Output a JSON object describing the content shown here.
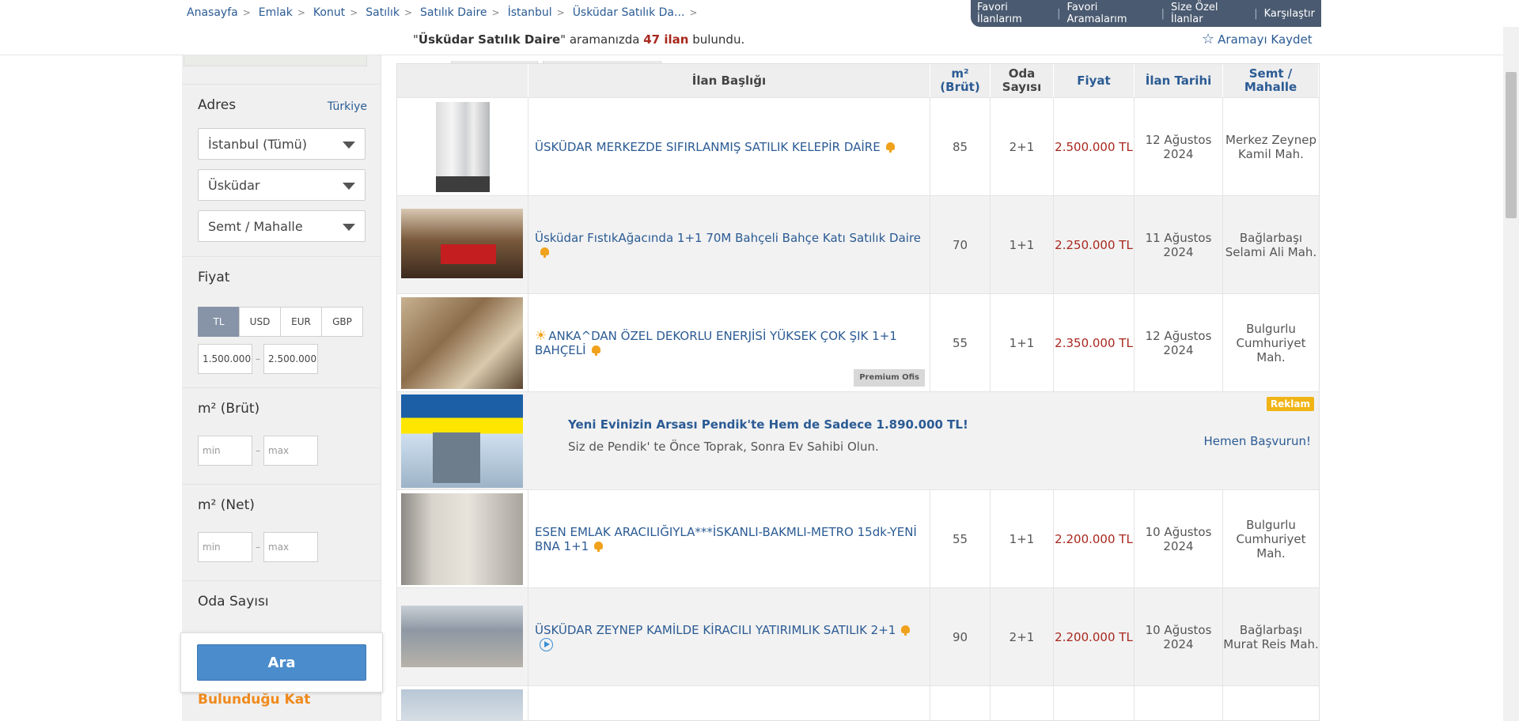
{
  "breadcrumb": [
    "Anasayfa",
    "Emlak",
    "Konut",
    "Satılık",
    "Satılık Daire",
    "İstanbul",
    "Üsküdar Satılık Da..."
  ],
  "topnav": [
    "Favori İlanlarım",
    "Favori Aramalarım",
    "Size Özel İlanlar",
    "Karşılaştır"
  ],
  "results": {
    "query": "Üsküdar Satılık Daire",
    "quote_open": "\"",
    "quote_close": "\"",
    "mid_text": "aramanızda",
    "count": "47 ilan",
    "suffix": "bulundu.",
    "save_label": "Aramayı Kaydet"
  },
  "sidebar": {
    "address": {
      "title": "Adres",
      "country_link": "Türkiye",
      "city": "İstanbul (Tümü)",
      "district": "Üsküdar",
      "neighborhood": "Semt / Mahalle"
    },
    "price": {
      "title": "Fiyat",
      "currencies": [
        "TL",
        "USD",
        "EUR",
        "GBP"
      ],
      "active_currency": "TL",
      "min": "1.500.000",
      "max": "2.500.000",
      "separator": "–"
    },
    "gross_area": {
      "title": "m² (Brüt)",
      "min_placeholder": "min",
      "max_placeholder": "max"
    },
    "net_area": {
      "title": "m² (Net)",
      "min_placeholder": "min",
      "max_placeholder": "max"
    },
    "rooms": {
      "title": "Oda Sayısı"
    },
    "floor": {
      "title": "Bulunduğu Kat"
    },
    "search_button": "Ara"
  },
  "table": {
    "headers": [
      "İlan Başlığı",
      "m² (Brüt)",
      "Oda Sayısı",
      "Fiyat",
      "İlan Tarihi",
      "Semt / Mahalle"
    ],
    "rows": [
      {
        "title": "ÜSKÜDAR MERKEZDE SIFIRLANMIŞ SATILIK KELEPİR DAİRE",
        "m2": "85",
        "rooms": "2+1",
        "price": "2.500.000 TL",
        "date": "12 Ağustos 2024",
        "location": "Merkez Zeynep Kamil Mah."
      },
      {
        "title": "Üsküdar FıstıkAğacında 1+1 70M Bahçeli Bahçe Katı Satılık Daire",
        "m2": "70",
        "rooms": "1+1",
        "price": "2.250.000 TL",
        "date": "11 Ağustos 2024",
        "location": "Bağlarbaşı Selami Ali Mah."
      },
      {
        "title": "ANKA^DAN ÖZEL DEKORLU ENERJİSİ YÜKSEK ÇOK ŞIK 1+1 BAHÇELİ",
        "m2": "55",
        "rooms": "1+1",
        "price": "2.350.000 TL",
        "date": "12 Ağustos 2024",
        "location": "Bulgurlu Cumhuriyet Mah.",
        "badge": "Premium Ofis"
      },
      {
        "title": "ESEN EMLAK ARACILIĞIYLA***İSKANLI-BAKMLI-METRO 15dk-YENİ BNA 1+1",
        "m2": "55",
        "rooms": "1+1",
        "price": "2.200.000 TL",
        "date": "10 Ağustos 2024",
        "location": "Bulgurlu Cumhuriyet Mah."
      },
      {
        "title": "ÜSKÜDAR ZEYNEP KAMİLDE KİRACILI YATIRIMLIK SATILIK 2+1",
        "m2": "90",
        "rooms": "2+1",
        "price": "2.200.000 TL",
        "date": "10 Ağustos 2024",
        "location": "Bağlarbaşı Murat Reis Mah."
      }
    ],
    "ad": {
      "title": "Yeni Evinizin Arsası Pendik'te Hem de Sadece 1.890.000 TL!",
      "subtitle": "Siz de Pendik' te Önce Toprak, Sonra Ev Sahibi Olun.",
      "badge": "Reklam",
      "cta": "Hemen Başvurun!"
    }
  },
  "colors": {
    "link": "#2b5b94",
    "price": "#a8281e",
    "accent_orange": "#f08a1c",
    "nav_bg": "#4a5a70",
    "button": "#4a8ccc"
  }
}
